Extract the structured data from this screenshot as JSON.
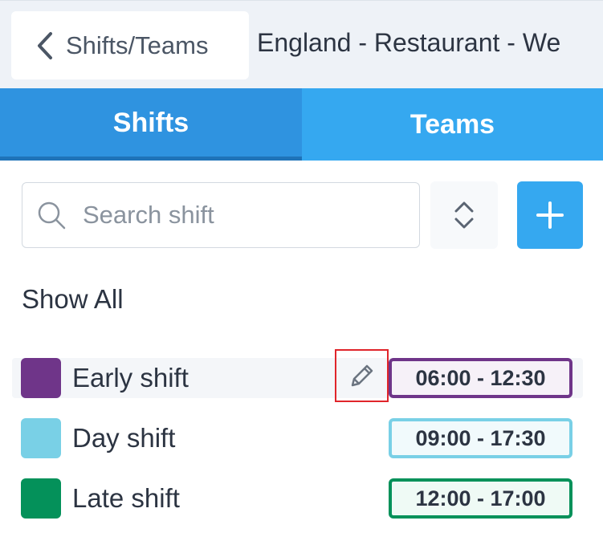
{
  "header": {
    "back_label": "Shifts/Teams",
    "location_title": "England - Restaurant - We"
  },
  "tabs": [
    {
      "label": "Shifts",
      "active": true
    },
    {
      "label": "Teams",
      "active": false
    }
  ],
  "search": {
    "placeholder": "Search shift",
    "value": ""
  },
  "filter": {
    "show_all_label": "Show All"
  },
  "shifts": [
    {
      "name": "Early shift",
      "time": "06:00 - 12:30",
      "color": "#6f3589",
      "badge_bg": "#f6f1f8"
    },
    {
      "name": "Day shift",
      "time": "09:00 - 17:30",
      "color": "#79d0e6",
      "badge_bg": "#f1fafc"
    },
    {
      "name": "Late shift",
      "time": "12:00 - 17:00",
      "color": "#04915a",
      "badge_bg": "#effaf5"
    }
  ],
  "colors": {
    "accent": "#35a8f0",
    "tab_active": "#2f93e0",
    "highlight_border": "#e0252b"
  },
  "icons": {
    "back": "chevron-left-icon",
    "search": "search-icon",
    "sort": "sort-icon",
    "add": "plus-icon",
    "edit": "pencil-icon"
  }
}
